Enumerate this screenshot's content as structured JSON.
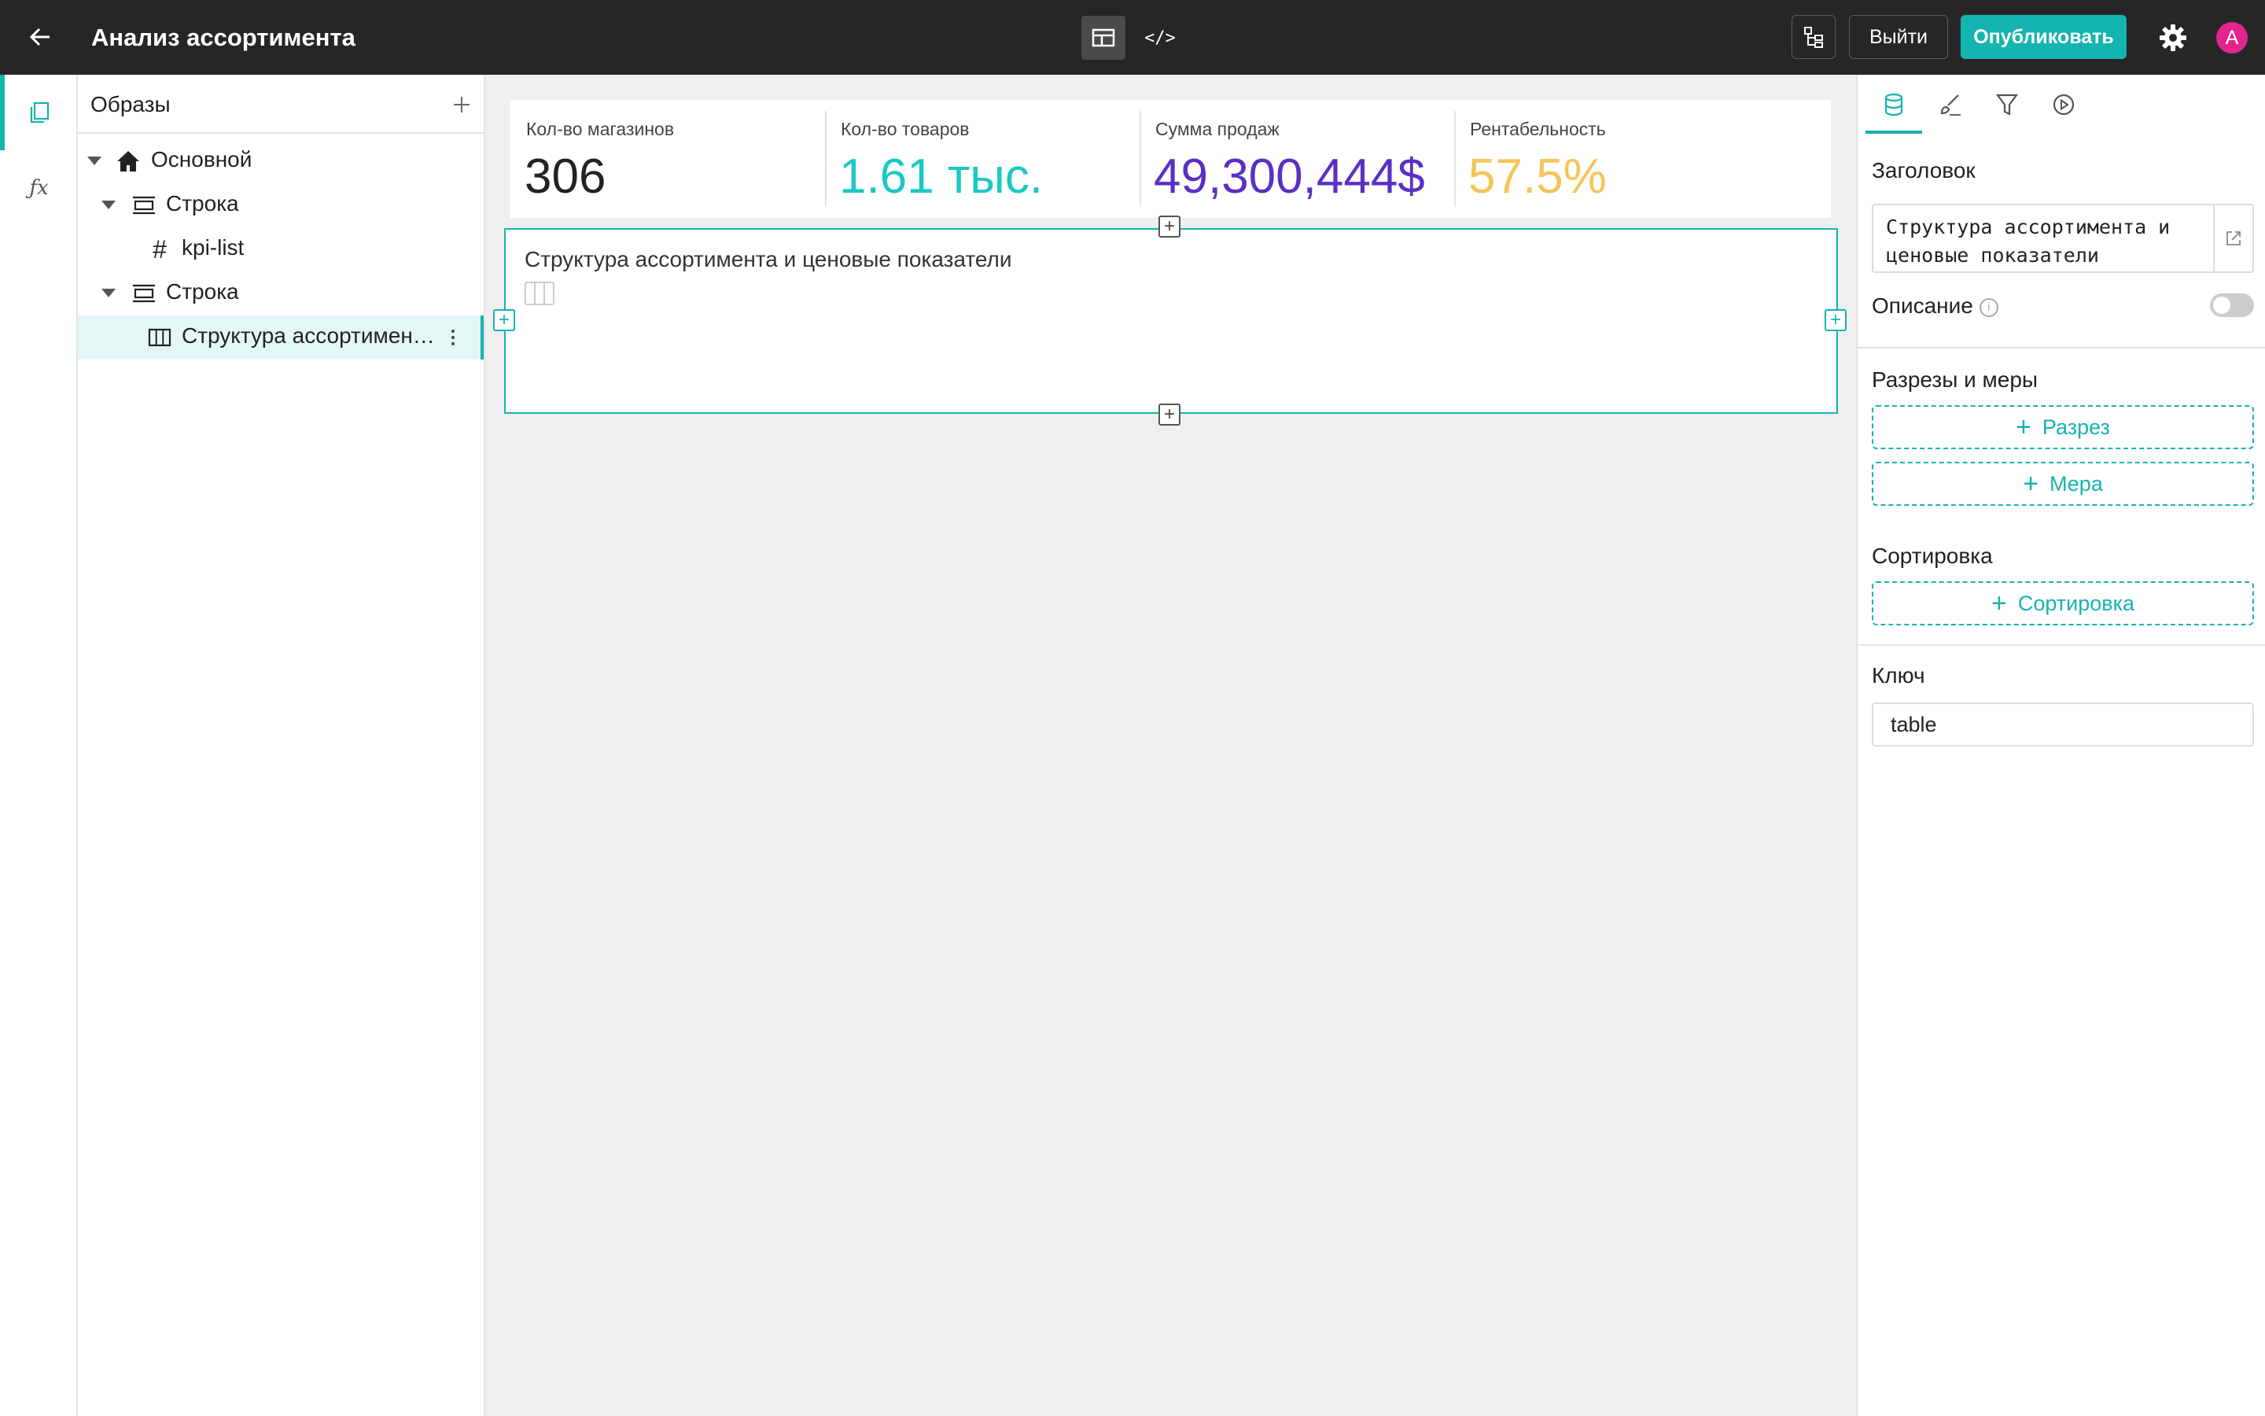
{
  "header": {
    "title": "Анализ ассортимента",
    "code_mode_label": "</>",
    "logout_label": "Выйти",
    "publish_label": "Опубликовать",
    "avatar_letter": "A"
  },
  "tree": {
    "header": "Образы",
    "items": [
      {
        "label": "Основной",
        "icon": "home-icon"
      },
      {
        "label": "Строка",
        "icon": "row-icon"
      },
      {
        "label": "kpi-list",
        "icon": "hash-icon"
      },
      {
        "label": "Строка",
        "icon": "row-icon"
      },
      {
        "label": "Структура ассортимен…",
        "icon": "table-icon",
        "selected": true
      }
    ]
  },
  "kpis": [
    {
      "label": "Кол-во магазинов",
      "value": "306",
      "color": "#222222"
    },
    {
      "label": "Кол-во товаров",
      "value": "1.61 тыс.",
      "color": "#1ac8c2"
    },
    {
      "label": "Сумма продаж",
      "value": "49,300,444$",
      "color": "#5a2fc4"
    },
    {
      "label": "Рентабельность",
      "value": "57.5%",
      "color": "#f5c55a"
    }
  ],
  "widget": {
    "title": "Структура ассортимента и ценовые показатели"
  },
  "props": {
    "heading_label": "Заголовок",
    "heading_value": "Структура ассортимента и ценовые показатели",
    "description_label": "Описание",
    "description_enabled": false,
    "dims_label": "Разрезы и меры",
    "add_dimension": "Разрез",
    "add_measure": "Мера",
    "sort_label": "Сортировка",
    "add_sort": "Сортировка",
    "key_label": "Ключ",
    "key_value": "table"
  },
  "colors": {
    "accent": "#14b4b0",
    "topbar": "#262626",
    "avatar": "#e2248f"
  }
}
